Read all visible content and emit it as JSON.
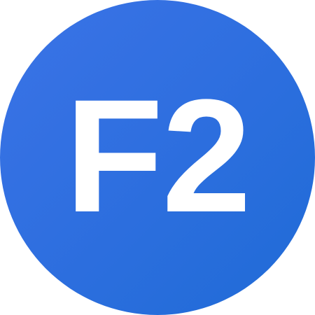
{
  "avatar": {
    "text": "F2",
    "colors": {
      "gradient_start": "#3b73e6",
      "gradient_mid": "#2f6fe0",
      "gradient_end": "#1f6bd6",
      "text": "#ffffff"
    }
  }
}
